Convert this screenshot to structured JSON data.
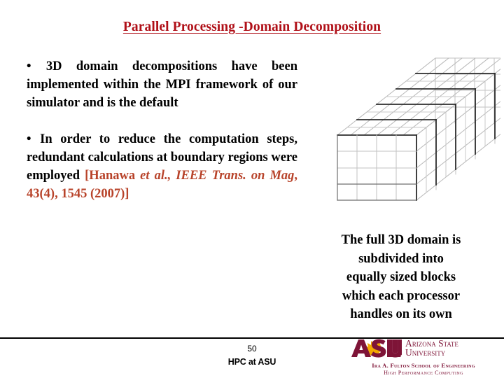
{
  "slide": {
    "title": "Parallel Processing -Domain Decomposition",
    "title_color": "#b01018",
    "background": "#ffffff"
  },
  "bullets": [
    {
      "marker": "•",
      "text": "3D domain decompositions have been implemented within the MPI framework of our simulator and is the default",
      "color": "#000000"
    },
    {
      "marker": "•",
      "text": "In order to reduce the computation steps, redundant calculations at boundary regions were employed",
      "color": "#000000",
      "citation": {
        "open_bracket": "[Hanawa ",
        "italic_part": "et al., IEEE Trans. on Mag",
        "tail": ", 43(4), 1545 (2007)]",
        "color": "#b8432a"
      }
    }
  ],
  "caption": {
    "lines": [
      "The full 3D domain is",
      "subdivided into",
      "equally sized blocks",
      "which each processor",
      "handles on its own"
    ]
  },
  "diagram": {
    "name": "3d-domain-decomposition-cube",
    "description": "Wireframe 3D box subdivided into equally sized blocks with slab separations",
    "grid_line_color": "#b4b4b4",
    "block_edge_color": "#222222",
    "slabs": 5,
    "columns": 4,
    "rows": 4
  },
  "footer": {
    "page_number": "50",
    "label": "HPC at ASU",
    "rule_color": "#000000"
  },
  "logo": {
    "mark_text": "ASU",
    "wordmark_line1": "Arizona State",
    "wordmark_line2": "University",
    "sub_line1": "Ira A. Fulton School of Engineering",
    "sub_line2": "High Performance Computing",
    "maroon": "#7e1437",
    "gold": "#f2a900"
  }
}
